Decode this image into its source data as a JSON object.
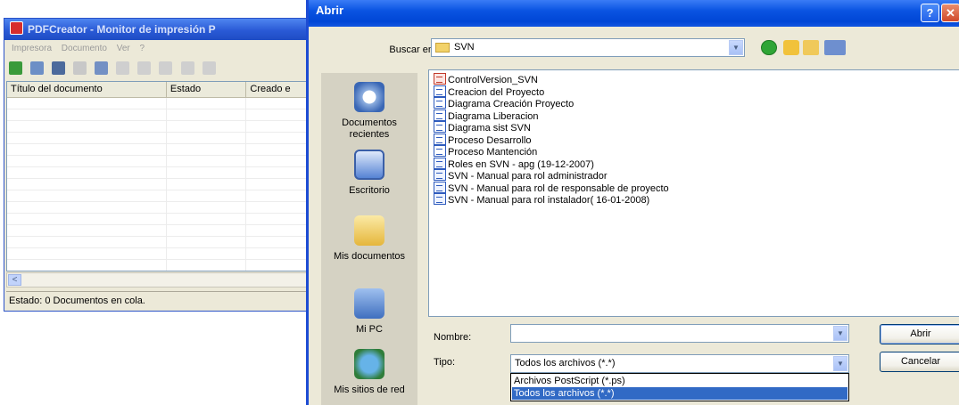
{
  "pdfcreator": {
    "title": "PDFCreator - Monitor de impresión P",
    "menu": [
      "Impresora",
      "Documento",
      "Ver",
      "?"
    ],
    "columns": [
      "Título del documento",
      "Estado",
      "Creado e"
    ],
    "scroll_left_glyph": "<",
    "status": "Estado: 0 Documentos en cola."
  },
  "dialog": {
    "title": "Abrir",
    "help_glyph": "?",
    "close_glyph": "✕",
    "look_in_label": "Buscar en:",
    "look_in_value": "SVN",
    "places": [
      {
        "label": "Documentos recientes",
        "icon": "recent-documents-icon"
      },
      {
        "label": "Escritorio",
        "icon": "desktop-icon"
      },
      {
        "label": "Mis documentos",
        "icon": "my-documents-icon"
      },
      {
        "label": "Mi PC",
        "icon": "my-computer-icon"
      },
      {
        "label": "Mis sitios de red",
        "icon": "network-places-icon"
      }
    ],
    "files": [
      {
        "name": "ControlVersion_SVN",
        "icon": "pdf"
      },
      {
        "name": "Creacion del Proyecto",
        "icon": "ps"
      },
      {
        "name": "Diagrama Creación Proyecto",
        "icon": "ps"
      },
      {
        "name": "Diagrama Liberacion",
        "icon": "ps"
      },
      {
        "name": "Diagrama sist SVN",
        "icon": "ps"
      },
      {
        "name": "Proceso Desarrollo",
        "icon": "ps"
      },
      {
        "name": "Proceso Mantención",
        "icon": "ps"
      },
      {
        "name": "Roles en SVN - apg (19-12-2007)",
        "icon": "doc"
      },
      {
        "name": "SVN - Manual para rol administrador",
        "icon": "doc"
      },
      {
        "name": "SVN - Manual para rol de responsable de proyecto",
        "icon": "doc"
      },
      {
        "name": "SVN - Manual para rol instalador( 16-01-2008)",
        "icon": "doc"
      }
    ],
    "name_label": "Nombre:",
    "name_value": "",
    "type_label": "Tipo:",
    "type_value": "Todos los archivos (*.*)",
    "type_options": [
      "Archivos PostScript (*.ps)",
      "Todos los archivos (*.*)"
    ],
    "open_button": "Abrir",
    "cancel_button": "Cancelar",
    "dropdown_glyph": "▼"
  },
  "colors": {
    "selection": "#316ac5",
    "xp_titlebar": "#0a54e2",
    "dialog_bg": "#ece9d8"
  }
}
